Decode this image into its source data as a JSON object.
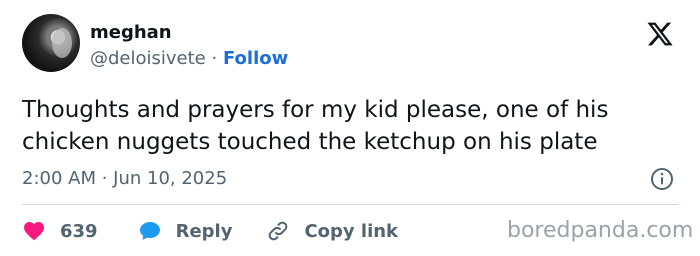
{
  "user": {
    "name": "meghan",
    "handle": "@deloisivete",
    "separator": "·",
    "follow_label": "Follow"
  },
  "tweet": {
    "line1": "Thoughts and prayers for my kid please, one of his",
    "line2": "chicken nuggets touched the ketchup on his plate",
    "timestamp": "2:00 AM · Jun 10, 2025"
  },
  "actions": {
    "likes": "639",
    "reply_label": "Reply",
    "copy_label": "Copy link"
  },
  "watermark": "boredpanda.com",
  "icons": {
    "like": "heart-icon",
    "reply": "reply-bubble-icon",
    "copy": "link-icon",
    "info": "info-icon",
    "brand": "x-logo-icon"
  },
  "colors": {
    "heart": "#f91880",
    "reply": "#1d9bf0",
    "follow": "#1d6fd8",
    "muted": "#536471"
  }
}
